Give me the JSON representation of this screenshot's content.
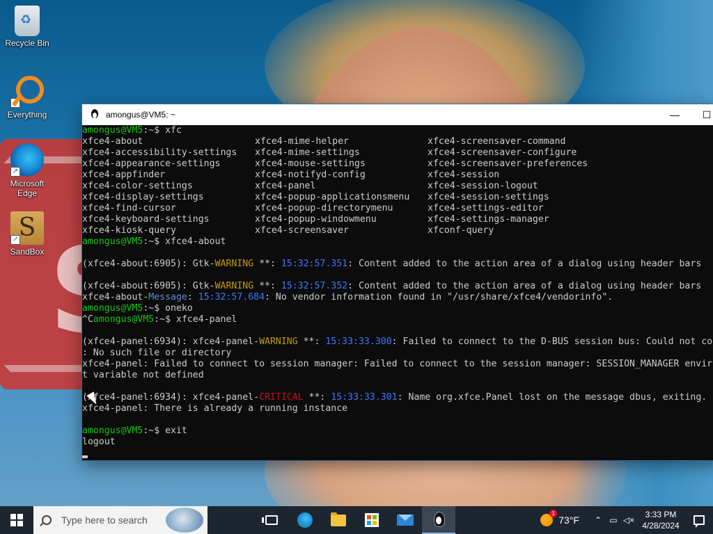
{
  "desktop": {
    "icons": [
      {
        "label": "Recycle Bin",
        "icon": "recycle-bin-icon"
      },
      {
        "label": "Everything",
        "icon": "everything-search-icon"
      },
      {
        "label": "Microsoft Edge",
        "icon": "edge-icon"
      },
      {
        "label": "SandBox",
        "icon": "sandbox-icon"
      }
    ]
  },
  "window": {
    "title": "amongus@VM5: ~",
    "controls": {
      "minimize": "—",
      "maximize": "☐"
    },
    "terminal": {
      "prompt_user": "amongus@VM5",
      "prompt_path": ":~$ ",
      "cmd1": "xfc",
      "completions": [
        [
          "xfce4-about",
          "xfce4-mime-helper",
          "xfce4-screensaver-command"
        ],
        [
          "xfce4-accessibility-settings",
          "xfce4-mime-settings",
          "xfce4-screensaver-configure"
        ],
        [
          "xfce4-appearance-settings",
          "xfce4-mouse-settings",
          "xfce4-screensaver-preferences"
        ],
        [
          "xfce4-appfinder",
          "xfce4-notifyd-config",
          "xfce4-session"
        ],
        [
          "xfce4-color-settings",
          "xfce4-panel",
          "xfce4-session-logout"
        ],
        [
          "xfce4-display-settings",
          "xfce4-popup-applicationsmenu",
          "xfce4-session-settings"
        ],
        [
          "xfce4-find-cursor",
          "xfce4-popup-directorymenu",
          "xfce4-settings-editor"
        ],
        [
          "xfce4-keyboard-settings",
          "xfce4-popup-windowmenu",
          "xfce4-settings-manager"
        ],
        [
          "xfce4-kiosk-query",
          "xfce4-screensaver",
          "xfconf-query"
        ]
      ],
      "cmd2": "xfce4-about",
      "warn1_prefix": "(xfce4-about:6905): Gtk-",
      "warn_word": "WARNING",
      "warn_stars": " **: ",
      "warn1_time": "15:32:57.351",
      "warn1_msg": ": Content added to the action area of a dialog using header bars",
      "warn2_time": "15:32:57.352",
      "msg_prefix": "xfce4-about-",
      "msg_word": "Message",
      "msg_time": "15:32:57.684",
      "msg_text": ": No vendor information found in \"/usr/share/xfce4/vendorinfo\".",
      "cmd3": "oneko",
      "ctrl_c": "^C",
      "cmd4": "xfce4-panel",
      "panel_warn_prefix": "(xfce4-panel:6934): xfce4-panel-",
      "panel_warn_time": "15:33:33.300",
      "panel_warn_msg": ": Failed to connect to the D-BUS session bus: Could not co",
      "panel_warn_cont": ": No such file or directory",
      "panel_err1": "xfce4-panel: Failed to connect to session manager: Failed to connect to the session manager: SESSION_MANAGER envir",
      "panel_err1_cont": "t variable not defined",
      "crit_prefix": "(xfce4-panel:6934): xfce4-panel-",
      "crit_word": "CRITICAL",
      "crit_time": "15:33:33.301",
      "crit_msg": ": Name org.xfce.Panel lost on the message dbus, exiting.",
      "running": "xfce4-panel: There is already a running instance",
      "cmd5": "exit",
      "logout": "logout"
    }
  },
  "taskbar": {
    "search_placeholder": "Type here to search",
    "weather_temp": "73°F",
    "weather_badge": "1",
    "time": "3:33 PM",
    "date": "4/28/2024"
  }
}
